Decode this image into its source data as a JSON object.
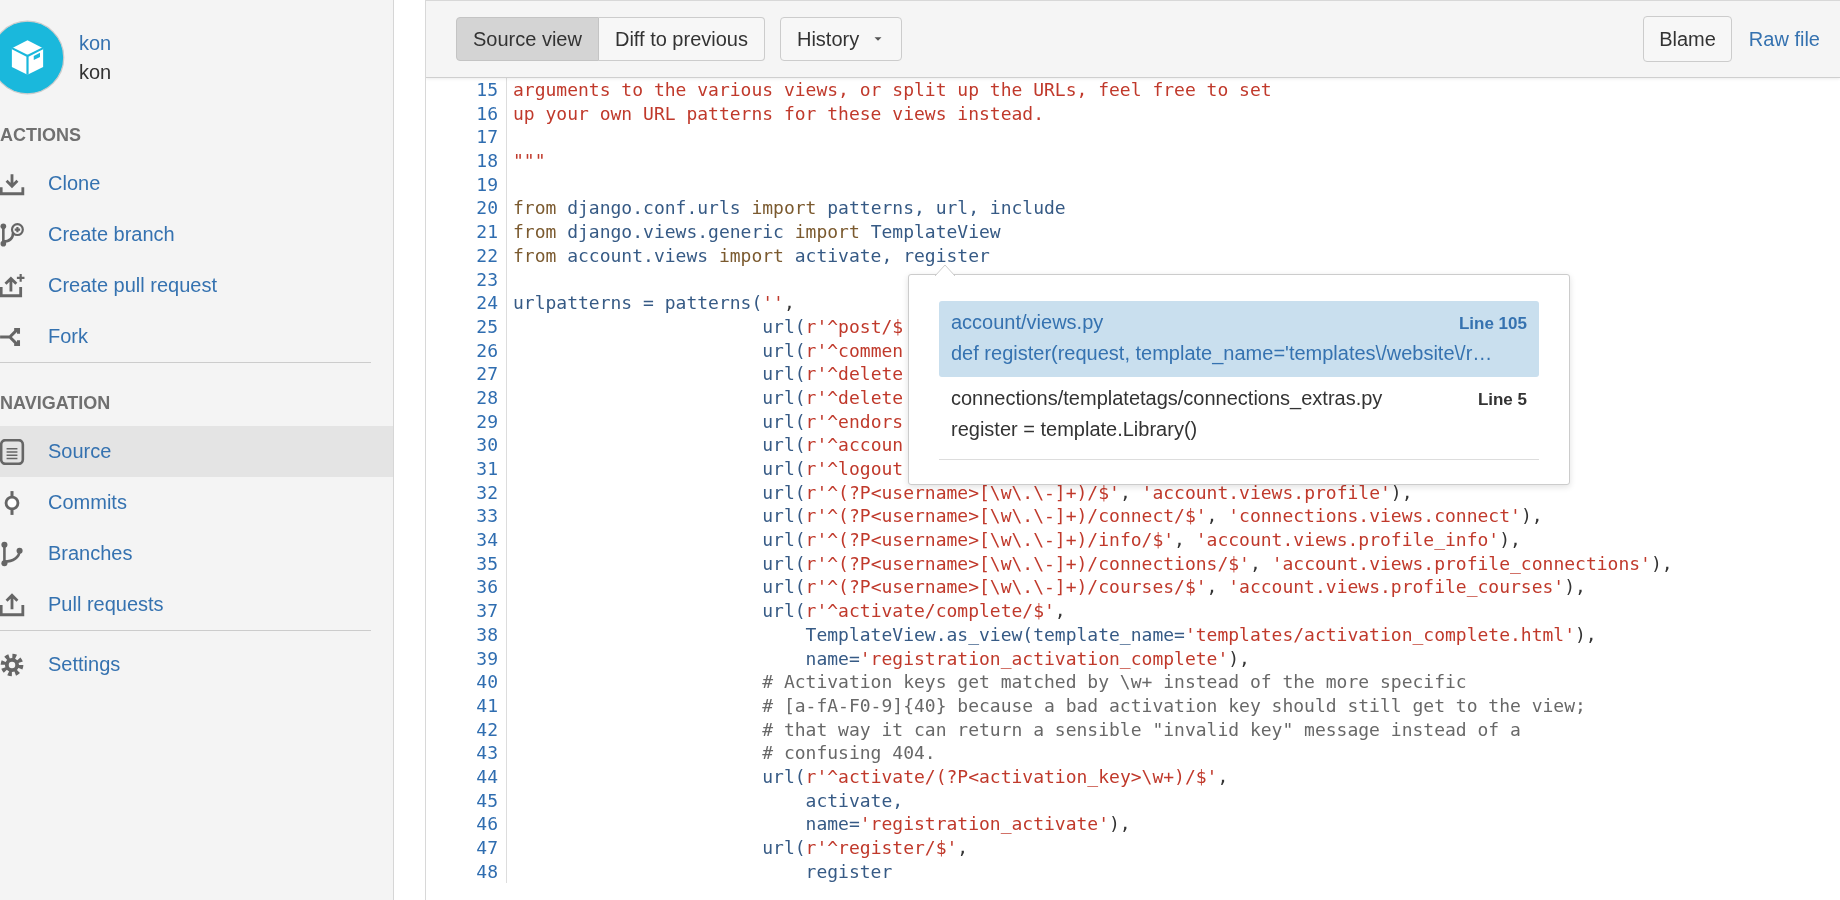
{
  "sidebar": {
    "repo": {
      "link": "kon",
      "name": "kon"
    },
    "sections": [
      {
        "heading": "ACTIONS",
        "items": [
          {
            "label": "Clone",
            "selected": false
          },
          {
            "label": "Create branch",
            "selected": false
          },
          {
            "label": "Create pull request",
            "selected": false
          },
          {
            "label": "Fork",
            "selected": false
          }
        ]
      },
      {
        "heading": "NAVIGATION",
        "items": [
          {
            "label": "Source",
            "selected": true
          },
          {
            "label": "Commits",
            "selected": false
          },
          {
            "label": "Branches",
            "selected": false
          },
          {
            "label": "Pull requests",
            "selected": false
          }
        ]
      },
      {
        "items": [
          {
            "label": "Settings",
            "selected": false
          }
        ]
      }
    ]
  },
  "toolbar": {
    "view_tabs": [
      {
        "label": "Source view",
        "selected": true
      },
      {
        "label": "Diff to previous",
        "selected": false
      }
    ],
    "history": {
      "label": "History"
    },
    "blame": {
      "label": "Blame"
    },
    "raw_file": {
      "label": "Raw file"
    }
  },
  "code": {
    "lines": [
      {
        "number": "15",
        "tokens": [
          {
            "kind": "str",
            "text": "arguments to the various views, or split up the URLs, feel free to set"
          }
        ]
      },
      {
        "number": "16",
        "tokens": [
          {
            "kind": "str",
            "text": "up your own URL patterns for these views instead."
          }
        ]
      },
      {
        "number": "17"
      },
      {
        "number": "18",
        "tokens": [
          {
            "kind": "str",
            "text": "\"\"\""
          }
        ]
      },
      {
        "number": "19"
      },
      {
        "number": "20",
        "tokens": [
          {
            "kind": "kw",
            "text": "from "
          },
          {
            "kind": "name",
            "text": "django.conf.urls "
          },
          {
            "kind": "kw",
            "text": "import "
          },
          {
            "kind": "name",
            "text": "patterns, url, include"
          }
        ]
      },
      {
        "number": "21",
        "tokens": [
          {
            "kind": "kw",
            "text": "from "
          },
          {
            "kind": "name",
            "text": "django.views.generic "
          },
          {
            "kind": "kw",
            "text": "import "
          },
          {
            "kind": "name",
            "text": "TemplateView"
          }
        ]
      },
      {
        "number": "22",
        "tokens": [
          {
            "kind": "kw",
            "text": "from "
          },
          {
            "kind": "name",
            "text": "account.views "
          },
          {
            "kind": "kw",
            "text": "import "
          },
          {
            "kind": "name",
            "text": "activate, register"
          }
        ]
      },
      {
        "number": "23"
      },
      {
        "number": "24",
        "tokens": [
          {
            "kind": "name",
            "text": "urlpatterns = patterns("
          },
          {
            "kind": "str",
            "text": "''"
          },
          {
            "kind": "plain",
            "text": ","
          }
        ]
      },
      {
        "number": "25",
        "tokens": [
          {
            "kind": "name",
            "text": "                       url("
          },
          {
            "kind": "str",
            "text": "r'^post/$"
          }
        ]
      },
      {
        "number": "26",
        "tokens": [
          {
            "kind": "name",
            "text": "                       url("
          },
          {
            "kind": "str",
            "text": "r'^commen"
          }
        ]
      },
      {
        "number": "27",
        "tokens": [
          {
            "kind": "name",
            "text": "                       url("
          },
          {
            "kind": "str",
            "text": "r'^delete"
          }
        ]
      },
      {
        "number": "28",
        "tokens": [
          {
            "kind": "name",
            "text": "                       url("
          },
          {
            "kind": "str",
            "text": "r'^delete"
          }
        ]
      },
      {
        "number": "29",
        "tokens": [
          {
            "kind": "name",
            "text": "                       url("
          },
          {
            "kind": "str",
            "text": "r'^endors"
          }
        ]
      },
      {
        "number": "30",
        "tokens": [
          {
            "kind": "name",
            "text": "                       url("
          },
          {
            "kind": "str",
            "text": "r'^accoun"
          }
        ]
      },
      {
        "number": "31",
        "tokens": [
          {
            "kind": "name",
            "text": "                       url("
          },
          {
            "kind": "str",
            "text": "r'^logout"
          }
        ]
      },
      {
        "number": "32",
        "tokens": [
          {
            "kind": "name",
            "text": "                       url("
          },
          {
            "kind": "str",
            "text": "r'^(?P<username>[\\w\\.\\-]+)/$'"
          },
          {
            "kind": "plain",
            "text": ", "
          },
          {
            "kind": "str",
            "text": "'account.views.profile'"
          },
          {
            "kind": "plain",
            "text": "),"
          }
        ]
      },
      {
        "number": "33",
        "tokens": [
          {
            "kind": "name",
            "text": "                       url("
          },
          {
            "kind": "str",
            "text": "r'^(?P<username>[\\w\\.\\-]+)/connect/$'"
          },
          {
            "kind": "plain",
            "text": ", "
          },
          {
            "kind": "str",
            "text": "'connections.views.connect'"
          },
          {
            "kind": "plain",
            "text": "),"
          }
        ]
      },
      {
        "number": "34",
        "tokens": [
          {
            "kind": "name",
            "text": "                       url("
          },
          {
            "kind": "str",
            "text": "r'^(?P<username>[\\w\\.\\-]+)/info/$'"
          },
          {
            "kind": "plain",
            "text": ", "
          },
          {
            "kind": "str",
            "text": "'account.views.profile_info'"
          },
          {
            "kind": "plain",
            "text": "),"
          }
        ]
      },
      {
        "number": "35",
        "tokens": [
          {
            "kind": "name",
            "text": "                       url("
          },
          {
            "kind": "str",
            "text": "r'^(?P<username>[\\w\\.\\-]+)/connections/$'"
          },
          {
            "kind": "plain",
            "text": ", "
          },
          {
            "kind": "str",
            "text": "'account.views.profile_connections'"
          },
          {
            "kind": "plain",
            "text": "),"
          }
        ]
      },
      {
        "number": "36",
        "tokens": [
          {
            "kind": "name",
            "text": "                       url("
          },
          {
            "kind": "str",
            "text": "r'^(?P<username>[\\w\\.\\-]+)/courses/$'"
          },
          {
            "kind": "plain",
            "text": ", "
          },
          {
            "kind": "str",
            "text": "'account.views.profile_courses'"
          },
          {
            "kind": "plain",
            "text": "),"
          }
        ]
      },
      {
        "number": "37",
        "tokens": [
          {
            "kind": "name",
            "text": "                       url("
          },
          {
            "kind": "str",
            "text": "r'^activate/complete/$'"
          },
          {
            "kind": "plain",
            "text": ","
          }
        ]
      },
      {
        "number": "38",
        "tokens": [
          {
            "kind": "name",
            "text": "                           TemplateView.as_view(template_name="
          },
          {
            "kind": "str",
            "text": "'templates/activation_complete.html'"
          },
          {
            "kind": "plain",
            "text": "),"
          }
        ]
      },
      {
        "number": "39",
        "tokens": [
          {
            "kind": "name",
            "text": "                           name="
          },
          {
            "kind": "str",
            "text": "'registration_activation_complete'"
          },
          {
            "kind": "plain",
            "text": "),"
          }
        ]
      },
      {
        "number": "40",
        "tokens": [
          {
            "kind": "comment",
            "text": "                       # Activation keys get matched by \\w+ instead of the more specific"
          }
        ]
      },
      {
        "number": "41",
        "tokens": [
          {
            "kind": "comment",
            "text": "                       # [a-fA-F0-9]{40} because a bad activation key should still get to the view;"
          }
        ]
      },
      {
        "number": "42",
        "tokens": [
          {
            "kind": "comment",
            "text": "                       # that way it can return a sensible \"invalid key\" message instead of a"
          }
        ]
      },
      {
        "number": "43",
        "tokens": [
          {
            "kind": "comment",
            "text": "                       # confusing 404."
          }
        ]
      },
      {
        "number": "44",
        "tokens": [
          {
            "kind": "name",
            "text": "                       url("
          },
          {
            "kind": "str",
            "text": "r'^activate/(?P<activation_key>\\w+)/$'"
          },
          {
            "kind": "plain",
            "text": ","
          }
        ]
      },
      {
        "number": "45",
        "tokens": [
          {
            "kind": "name",
            "text": "                           activate,"
          }
        ]
      },
      {
        "number": "46",
        "tokens": [
          {
            "kind": "name",
            "text": "                           name="
          },
          {
            "kind": "str",
            "text": "'registration_activate'"
          },
          {
            "kind": "plain",
            "text": "),"
          }
        ]
      },
      {
        "number": "47",
        "tokens": [
          {
            "kind": "name",
            "text": "                       url("
          },
          {
            "kind": "str",
            "text": "r'^register/$'"
          },
          {
            "kind": "plain",
            "text": ","
          }
        ]
      },
      {
        "number": "48",
        "tokens": [
          {
            "kind": "name",
            "text": "                           register"
          }
        ]
      }
    ]
  },
  "popup": {
    "results": [
      {
        "path": "account/views.py",
        "line": "Line 105",
        "snippet": "def register(request, template_name='templates\\/website\\/r…",
        "selected": true
      },
      {
        "path": "connections/templatetags/connections_extras.py",
        "line": "Line 5",
        "snippet": "register = template.Library()",
        "selected": false
      }
    ]
  }
}
